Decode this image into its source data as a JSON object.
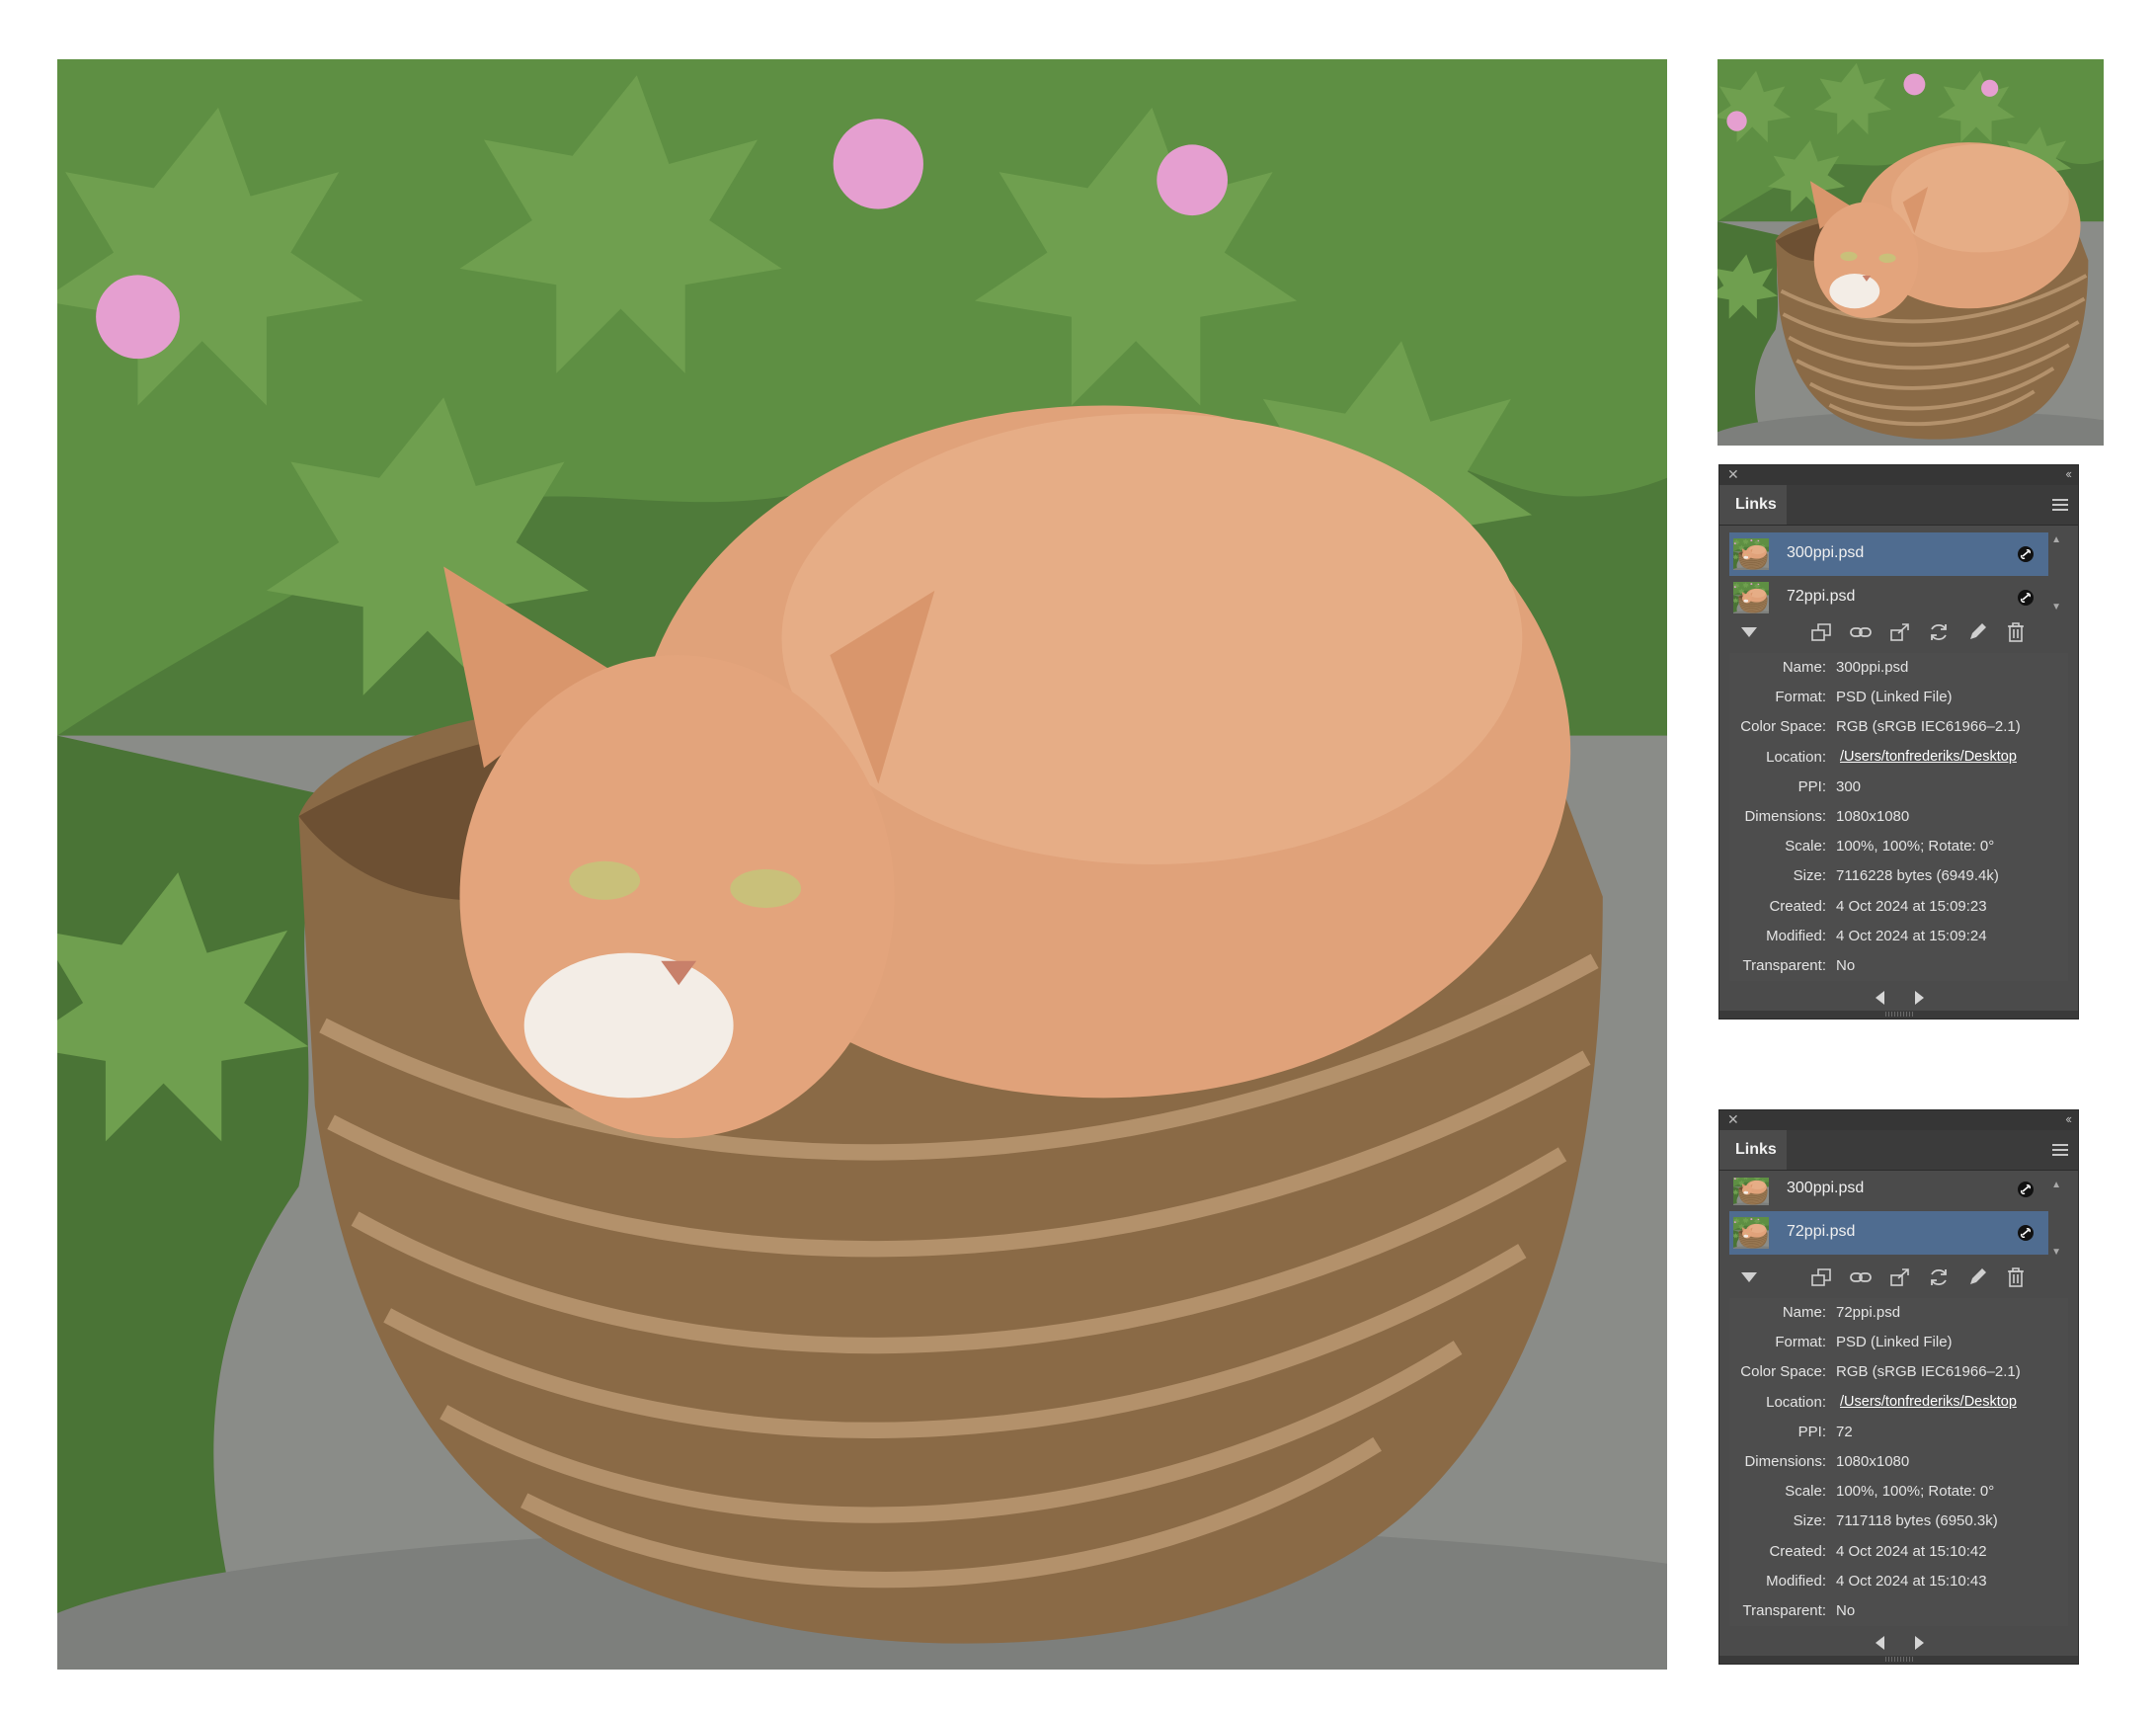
{
  "panels": [
    {
      "title": "Links",
      "links": [
        {
          "name": "300ppi.psd",
          "selected": true
        },
        {
          "name": "72ppi.psd",
          "selected": false
        }
      ],
      "info": [
        {
          "key": "Name:",
          "value": "300ppi.psd"
        },
        {
          "key": "Format:",
          "value": "PSD (Linked File)"
        },
        {
          "key": "Color Space:",
          "value": "RGB (sRGB IEC61966–2.1)"
        },
        {
          "key": "Location:",
          "value": "/Users/tonfrederiks/Desktop"
        },
        {
          "key": "PPI:",
          "value": "300"
        },
        {
          "key": "Dimensions:",
          "value": "1080x1080"
        },
        {
          "key": "Scale:",
          "value": "100%, 100%; Rotate: 0°"
        },
        {
          "key": "Size:",
          "value": "7116228 bytes (6949.4k)"
        },
        {
          "key": "Created:",
          "value": "4 Oct 2024 at 15:09:23"
        },
        {
          "key": "Modified:",
          "value": "4 Oct 2024 at 15:09:24"
        },
        {
          "key": "Transparent:",
          "value": "No"
        }
      ]
    },
    {
      "title": "Links",
      "links": [
        {
          "name": "300ppi.psd",
          "selected": false
        },
        {
          "name": "72ppi.psd",
          "selected": true
        }
      ],
      "info": [
        {
          "key": "Name:",
          "value": "72ppi.psd"
        },
        {
          "key": "Format:",
          "value": "PSD (Linked File)"
        },
        {
          "key": "Color Space:",
          "value": "RGB (sRGB IEC61966–2.1)"
        },
        {
          "key": "Location:",
          "value": "/Users/tonfrederiks/Desktop"
        },
        {
          "key": "PPI:",
          "value": "72"
        },
        {
          "key": "Dimensions:",
          "value": "1080x1080"
        },
        {
          "key": "Scale:",
          "value": "100%, 100%; Rotate: 0°"
        },
        {
          "key": "Size:",
          "value": "7117118 bytes (6950.3k)"
        },
        {
          "key": "Created:",
          "value": "4 Oct 2024 at 15:10:42"
        },
        {
          "key": "Modified:",
          "value": "4 Oct 2024 at 15:10:43"
        },
        {
          "key": "Transparent:",
          "value": "No"
        }
      ]
    }
  ],
  "colors": {
    "panel_bg": "#4b4b4b",
    "selection": "#4f6c90",
    "titlebar": "#363636"
  },
  "icons": [
    "close-icon",
    "collapse-icon",
    "panel-menu-icon",
    "link-status-icon",
    "show-info-triangle-icon",
    "relink-folder-icon",
    "relink-icon",
    "go-to-link-icon",
    "update-link-icon",
    "edit-original-icon",
    "trash-icon",
    "previous-arrow-icon",
    "next-arrow-icon"
  ]
}
